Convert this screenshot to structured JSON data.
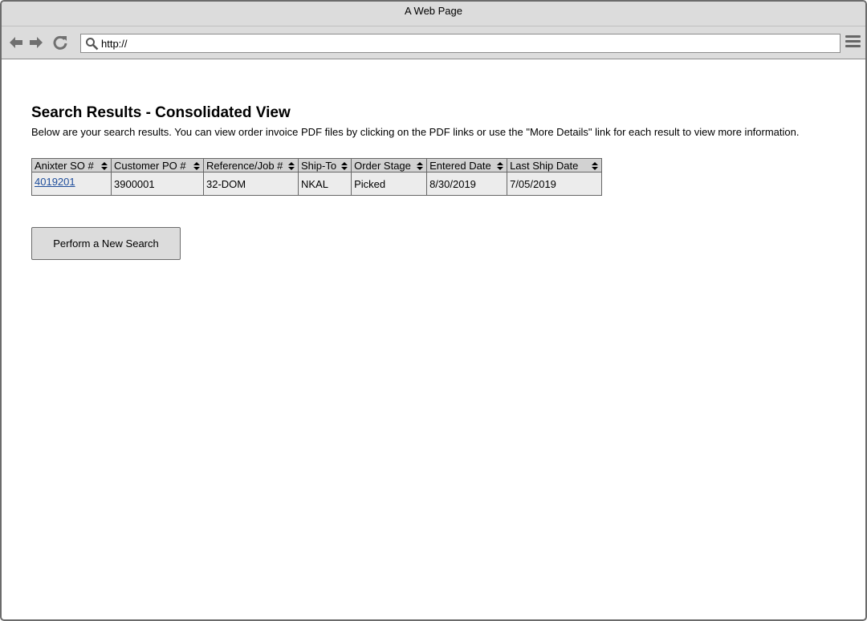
{
  "window": {
    "title": "A Web Page"
  },
  "toolbar": {
    "url": "http://"
  },
  "main": {
    "title": "Search Results - Consolidated View",
    "description": "Below are your search results. You can view order invoice PDF files by clicking on the PDF links or use the \"More Details\" link for each result to view more information."
  },
  "table": {
    "columns": [
      "Anixter SO #",
      "Customer PO #",
      "Reference/Job #",
      "Ship-To",
      "Order Stage",
      "Entered Date",
      "Last Ship Date"
    ],
    "rows": [
      [
        "4019201",
        "3900001",
        "32-DOM",
        "NKAL",
        "Picked",
        "8/30/2019",
        "7/05/2019"
      ]
    ]
  },
  "actions": {
    "new_search_label": "Perform a New Search"
  }
}
